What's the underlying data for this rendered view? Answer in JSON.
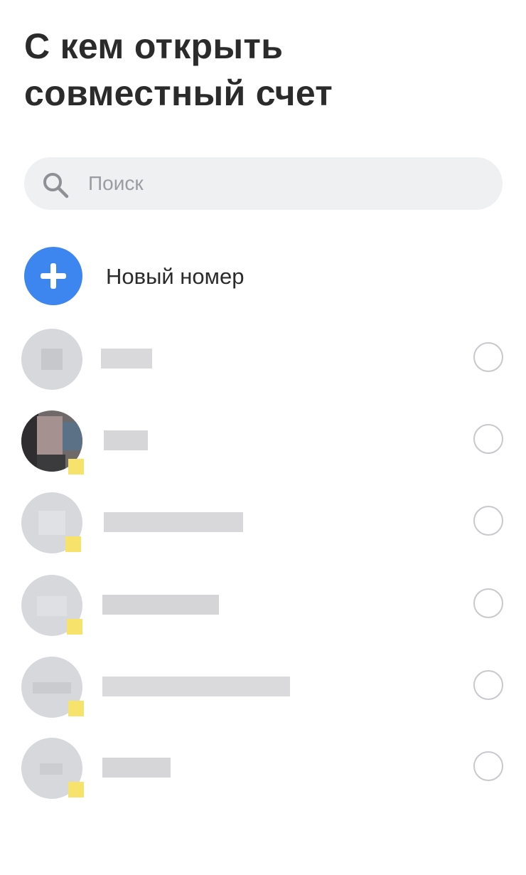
{
  "header": {
    "title_line1": "С кем открыть",
    "title_line2": "совместный счет"
  },
  "search": {
    "placeholder": "Поиск",
    "icon": "search-icon"
  },
  "new_number": {
    "label": "Новый номер",
    "icon": "plus-icon",
    "accent_color": "#3d86f0"
  },
  "contacts": [
    {
      "name": "",
      "selected": false
    },
    {
      "name": "",
      "selected": false
    },
    {
      "name": "",
      "selected": false
    },
    {
      "name": "",
      "selected": false
    },
    {
      "name": "",
      "selected": false
    },
    {
      "name": "",
      "selected": false
    }
  ],
  "colors": {
    "title": "#2b2b2b",
    "search_bg": "#eff0f2",
    "badge": "#f7e36b",
    "radio_border": "#c8c9cc"
  }
}
